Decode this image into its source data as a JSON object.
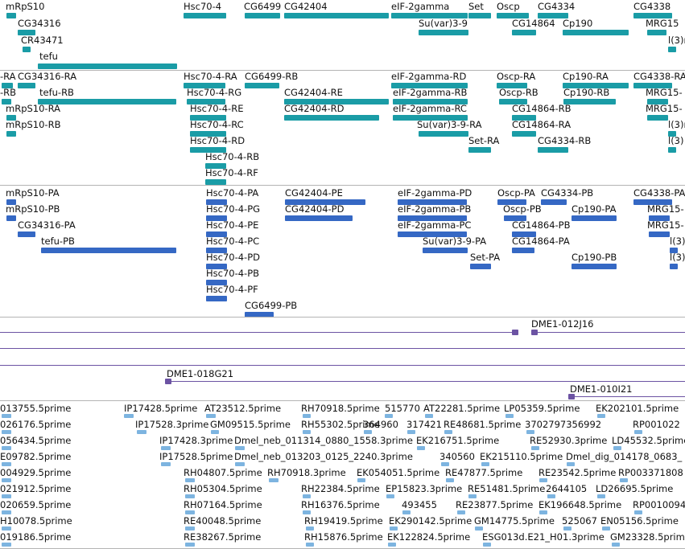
{
  "colors": {
    "gene": "#1a9ca6",
    "transcript": "#1a9ca6",
    "protein": "#3568c4",
    "clone": "#6c53a3",
    "est": "#7db4e0",
    "separator": "#b4b4b4"
  },
  "tracks": {
    "genes": {
      "labels": [
        "mRpS10",
        "CG34316",
        "CR43471",
        "tefu",
        "Hsc70-4",
        "CG6499",
        "CG42404",
        "eIF-2gamma",
        "Set",
        "Su(var)3-9",
        "Oscp",
        "CG14864",
        "CG4334",
        "Cp190",
        "CG4338",
        "MRG15",
        "l(3)r"
      ]
    },
    "transcripts": {
      "labels": [
        "-RA",
        "CG34316-RA",
        "-RB",
        "tefu-RB",
        "mRpS10-RA",
        "mRpS10-RB",
        "Hsc70-4-RA",
        "CG6499-RB",
        "Hsc70-4-RG",
        "Hsc70-4-RE",
        "Hsc70-4-RC",
        "Hsc70-4-RD",
        "Hsc70-4-RB",
        "Hsc70-4-RF",
        "CG42404-RE",
        "CG42404-RD",
        "eIF-2gamma-RD",
        "eIF-2gamma-RB",
        "eIF-2gamma-RC",
        "Su(var)3-9-RA",
        "Set-RA",
        "Oscp-RA",
        "Oscp-RB",
        "CG14864-RB",
        "CG14864-RA",
        "CG4334-RB",
        "Cp190-RA",
        "Cp190-RB",
        "CG4338-RA",
        "MRG15-",
        "MRG15-",
        "l(3)n",
        "l(3)"
      ]
    },
    "proteins": {
      "labels": [
        "mRpS10-PA",
        "mRpS10-PB",
        "CG34316-PA",
        "tefu-PB",
        "Hsc70-4-PA",
        "Hsc70-4-PG",
        "Hsc70-4-PE",
        "Hsc70-4-PC",
        "Hsc70-4-PD",
        "Hsc70-4-PB",
        "Hsc70-4-PF",
        "CG6499-PB",
        "CG42404-PE",
        "CG42404-PD",
        "eIF-2gamma-PD",
        "eIF-2gamma-PB",
        "eIF-2gamma-PC",
        "Su(var)3-9-PA",
        "Set-PA",
        "Oscp-PA",
        "Oscp-PB",
        "CG14864-PB",
        "CG14864-PA",
        "CG4334-PB",
        "Cp190-PA",
        "Cp190-PB",
        "CG4338-PA",
        "MRG15-",
        "MRG15-",
        "l(3)",
        "l(3)"
      ]
    },
    "clones": {
      "labels": [
        "DME1-012J16",
        "DME1-018G21",
        "DME1-010I21"
      ]
    },
    "ests": {
      "labels": [
        "013755.5prime",
        "IP17428.5prime",
        "AT23512.5prime",
        "RH70918.5prime",
        "515770",
        "AT22281.5prime",
        "LP05359.5prime",
        "EK202101.5prime",
        "026176.5prime",
        "IP17528.3prime",
        "GM09515.5prime",
        "RH55302.5prime",
        "364960",
        "317421",
        "RE48681.5prime",
        "3702797356992",
        "RP001022",
        "056434.5prime",
        "IP17428.3prime",
        "Dmel_neb_011314_0880_1558.3prime",
        "EK216751.5prime",
        "RE52930.3prime",
        "LD45532.5prime",
        "E09782.5prime",
        "IP17528.5prime",
        "Dmel_neb_013203_0125_2240.3prime",
        "340560",
        "EK215110.5prime",
        "Dmel_dig_014178_0683_",
        "004929.5prime",
        "RH04807.5prime",
        "RH70918.3prime",
        "EK054051.5prime",
        "RE47877.5prime",
        "RE23542.5prime",
        "RP003371808",
        "021912.5prime",
        "RH05304.5prime",
        "RH22384.5prime",
        "EP15823.3prime",
        "RE51481.5prime",
        "2644105",
        "LD26695.5prime",
        "020659.5prime",
        "RH07164.5prime",
        "RH16376.5prime",
        "493455",
        "RE23877.5prime",
        "EK196648.5prime",
        "RP0010094",
        "H10078.5prime",
        "RE40048.5prime",
        "RH19419.5prime",
        "EK290142.5prime",
        "GM14775.5prime",
        "525067",
        "EN05156.5prime",
        "019186.5prime",
        "RE38267.5prime",
        "RH15876.5prime",
        "EK122824.5prime",
        "ESG013d.E21_H01.3prime",
        "GM23328.5prime"
      ]
    }
  }
}
